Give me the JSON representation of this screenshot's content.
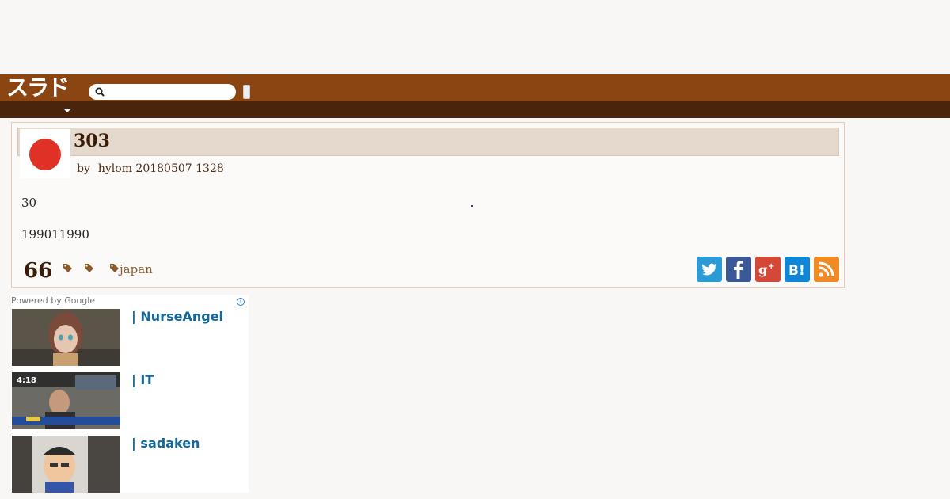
{
  "site": {
    "logo_text": "スラド"
  },
  "search": {
    "placeholder": ""
  },
  "article": {
    "title": "303",
    "by_label": "by",
    "author_date": "hylom 20180507 1328",
    "paragraphs": [
      "30",
      "199011990"
    ],
    "comment_count": "66",
    "tags": [
      "",
      "",
      "japan"
    ]
  },
  "share": {
    "twitter": "twitter-icon",
    "facebook": "facebook-icon",
    "google_plus": "google-plus-icon",
    "hatena": "hatena-bookmark-icon",
    "rss": "rss-icon"
  },
  "ads": {
    "powered_by": "Powered by Google",
    "info_glyph": "i",
    "items": [
      {
        "title": "| NurseAngel"
      },
      {
        "title": "|  IT"
      },
      {
        "title": "| sadaken"
      }
    ]
  },
  "colors": {
    "header": "#8b4513",
    "subheader": "#4a240b",
    "title_bar": "#e4d9cc",
    "ad_link": "#13679a"
  }
}
